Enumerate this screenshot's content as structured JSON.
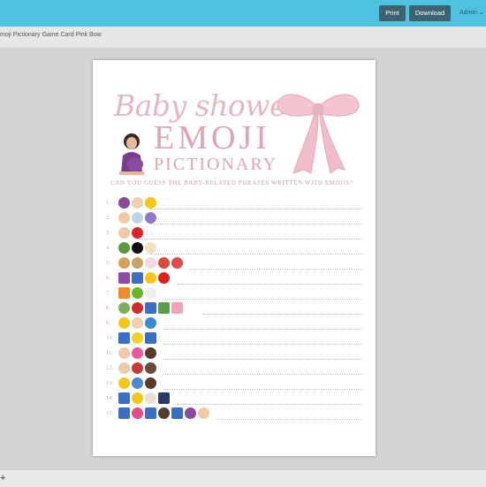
{
  "toolbar": {
    "print_label": "Print",
    "download_label": "Download",
    "admin_label": "Admin ⌄"
  },
  "breadcrumb": "moji Pictionary Game Card Pink Bow",
  "card": {
    "title_script": "Baby shower",
    "title_main": "EMOJI",
    "title_sub": "PICTIONARY",
    "instruction": "CAN YOU GUESS THE BABY-RELATED PHRASES WRITTEN WITH EMOJIS?",
    "items": [
      {
        "num": "1.",
        "emojis": [
          "woman",
          "victory-hand",
          "bee"
        ]
      },
      {
        "num": "2.",
        "emojis": [
          "baby",
          "cloud-rain",
          "umbrella"
        ]
      },
      {
        "num": "3.",
        "emojis": [
          "baby",
          "red-heart"
        ]
      },
      {
        "num": "4.",
        "emojis": [
          "cucumber",
          "plus",
          "ice-cream"
        ]
      },
      {
        "num": "5.",
        "emojis": [
          "baguette",
          "toast",
          "birthday-cake",
          "spoon",
          "hot-springs"
        ]
      },
      {
        "num": "6.",
        "emojis": [
          "womens-room",
          "information",
          "thinking-face",
          "question-mark"
        ]
      },
      {
        "num": "7.",
        "emojis": [
          "sunset",
          "green-circle",
          "stork"
        ]
      },
      {
        "num": "8.",
        "emojis": [
          "house",
          "car",
          "right-arrow",
          "road",
          "hospital"
        ]
      },
      {
        "num": "9.",
        "emojis": [
          "smiley",
          "victory-hand",
          "globe"
        ]
      },
      {
        "num": "10.",
        "emojis": [
          "turn-right-arrow",
          "crescent-moon",
          "down-arrow"
        ]
      },
      {
        "num": "11.",
        "emojis": [
          "clap",
          "bow-ribbon",
          "girl"
        ]
      },
      {
        "num": "12.",
        "emojis": [
          "clap",
          "train",
          "boy"
        ]
      },
      {
        "num": "13.",
        "emojis": [
          "sleeping-face",
          "zzz",
          "mother"
        ]
      },
      {
        "num": "14.",
        "emojis": [
          "up-button",
          "dizzy-face",
          "baby-bottle",
          "night-city"
        ]
      },
      {
        "num": "15.",
        "emojis": [
          "keycap-1",
          "heart-arrow",
          "keycap-2",
          "woman-face",
          "keycap-3",
          "woman",
          "baby"
        ]
      }
    ]
  },
  "colors": {
    "topbar": "#4ec3e0",
    "button": "#3c6470",
    "title_pink": "#dca5b0",
    "bow_pink": "#f2c5cf"
  }
}
